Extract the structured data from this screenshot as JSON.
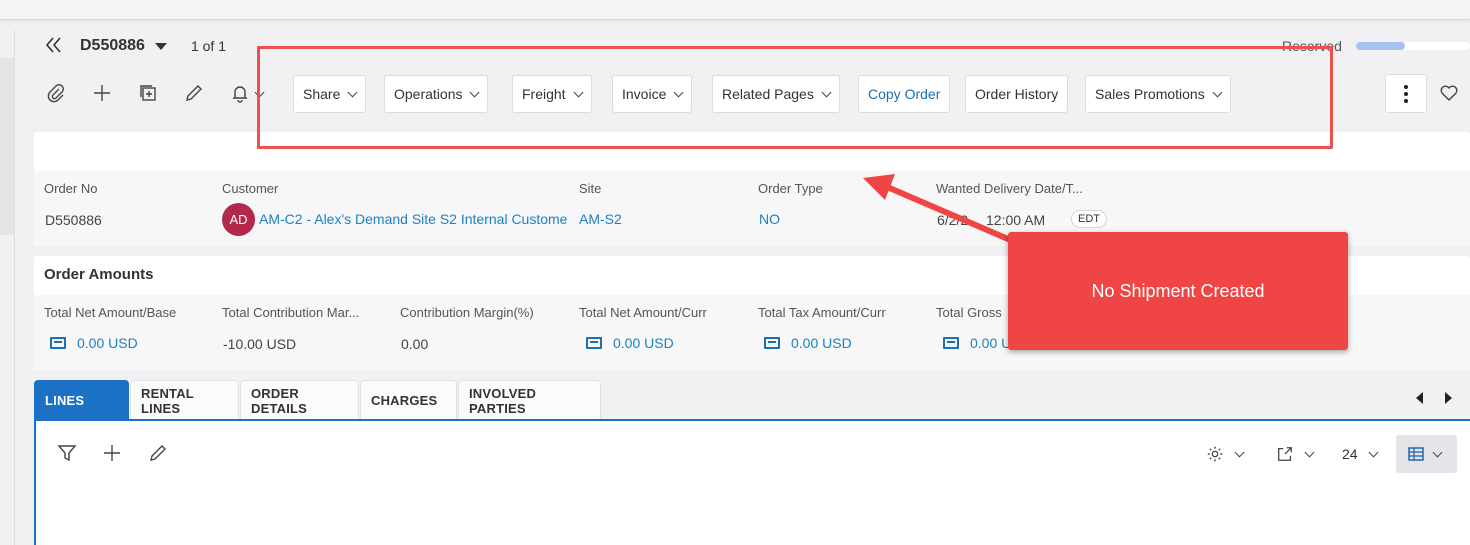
{
  "header": {
    "record_id": "D550886",
    "pager": "1 of 1",
    "status": "Reserved",
    "status_progress": 0.43
  },
  "toolbar": {
    "icons": [
      "paperclip-icon",
      "plus-icon",
      "duplicate-icon",
      "pencil-icon",
      "bell-icon"
    ],
    "buttons": {
      "share": "Share",
      "operations": "Operations",
      "freight": "Freight",
      "invoice": "Invoice",
      "related_pages": "Related Pages",
      "copy_order": "Copy Order",
      "order_history": "Order History",
      "sales_promotions": "Sales Promotions"
    }
  },
  "order": {
    "order_no_label": "Order No",
    "order_no": "D550886",
    "customer_label": "Customer",
    "customer_initials": "AD",
    "customer": "AM-C2 - Alex's Demand Site S2 Internal Custome",
    "site_label": "Site",
    "site": "AM-S2",
    "order_type_label": "Order Type",
    "order_type": "NO",
    "wanted_delivery_label": "Wanted Delivery Date/T...",
    "wanted_delivery": "6/2/2",
    "wanted_delivery_time": "12:00 AM",
    "timezone": "EDT"
  },
  "amounts": {
    "title": "Order Amounts",
    "fields": [
      {
        "label": "Total Net Amount/Base",
        "value": "0.00 USD"
      },
      {
        "label": "Total Contribution Mar...",
        "value": "-10.00 USD"
      },
      {
        "label": "Contribution Margin(%)",
        "value": "0.00"
      },
      {
        "label": "Total Net Amount/Curr",
        "value": "0.00 USD"
      },
      {
        "label": "Total Tax Amount/Curr",
        "value": "0.00 USD"
      },
      {
        "label": "Total Gross",
        "value": "0.00 U"
      }
    ]
  },
  "tabs": [
    "LINES",
    "RENTAL LINES",
    "ORDER DETAILS",
    "CHARGES",
    "INVOLVED PARTIES"
  ],
  "lines_toolbar": {
    "page_size": "24"
  },
  "annotation": {
    "callout_text": "No Shipment Created"
  },
  "colors": {
    "accent": "#1b72c4",
    "link": "#1b82bf",
    "annotation_red": "#f04545",
    "avatar": "#b3294b"
  }
}
